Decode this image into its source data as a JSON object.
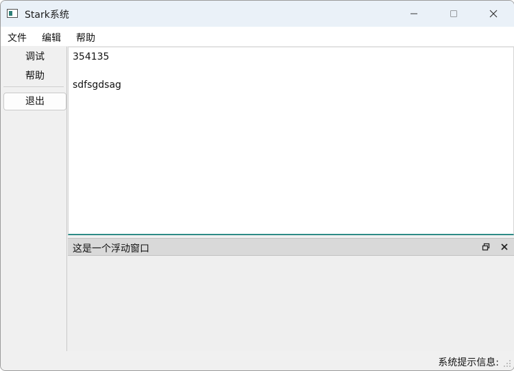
{
  "window": {
    "title": "Stark系统",
    "icon": "app-window-icon",
    "controls": [
      "minimize-icon",
      "maximize-icon",
      "close-icon"
    ]
  },
  "menubar": {
    "items": [
      {
        "label": "文件"
      },
      {
        "label": "编辑"
      },
      {
        "label": "帮助"
      }
    ]
  },
  "toolbox": {
    "items": [
      {
        "label": "调试"
      },
      {
        "label": "帮助"
      }
    ],
    "exit_label": "退出"
  },
  "editor": {
    "lines": [
      "354135",
      "",
      "sdfsgdsag"
    ],
    "focus_color": "#2e8b86"
  },
  "dock": {
    "title": "这是一个浮动窗口",
    "buttons": [
      "float-icon",
      "close-icon"
    ]
  },
  "statusbar": {
    "message": "系统提示信息:"
  }
}
